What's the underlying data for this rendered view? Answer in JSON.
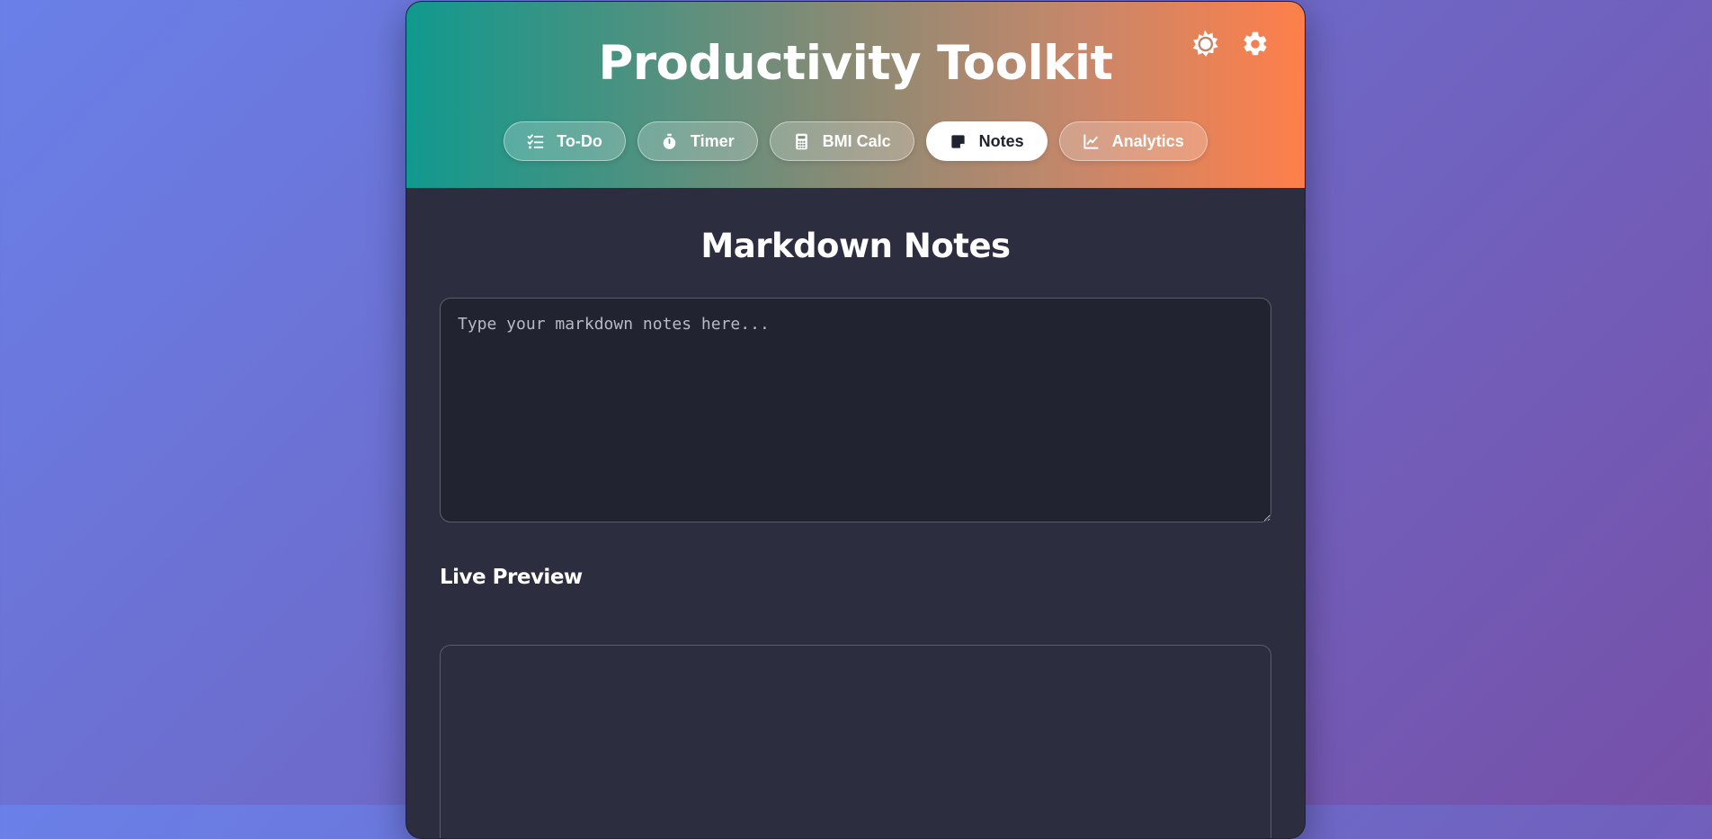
{
  "header": {
    "title": "Productivity Toolkit",
    "icons": [
      "brightness-icon",
      "gear-icon"
    ]
  },
  "tabs": [
    {
      "label": "To-Do",
      "icon": "checklist-icon",
      "active": false
    },
    {
      "label": "Timer",
      "icon": "stopwatch-icon",
      "active": false
    },
    {
      "label": "BMI Calc",
      "icon": "calculator-icon",
      "active": false
    },
    {
      "label": "Notes",
      "icon": "sticky-note-icon",
      "active": true
    },
    {
      "label": "Analytics",
      "icon": "line-chart-icon",
      "active": false
    }
  ],
  "notes": {
    "title": "Markdown Notes",
    "placeholder": "Type your markdown notes here...",
    "value": "",
    "preview_title": "Live Preview",
    "preview_content": ""
  },
  "colors": {
    "header_gradient_start": "#11998e",
    "header_gradient_end": "#ff7f4a",
    "panel_background": "#2d2d40",
    "input_background": "#222331"
  }
}
